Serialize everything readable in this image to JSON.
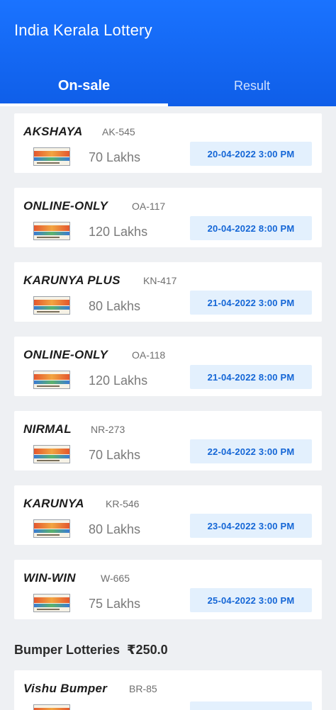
{
  "header": {
    "title": "India Kerala Lottery",
    "tabs": [
      {
        "label": "On-sale",
        "active": true
      },
      {
        "label": "Result",
        "active": false
      }
    ],
    "color": "#1a73ff"
  },
  "lotteries": [
    {
      "name": "AKSHAYA",
      "code": "AK-545",
      "prize": "70 Lakhs",
      "date": "20-04-2022  3:00 PM"
    },
    {
      "name": "ONLINE-ONLY",
      "code": "OA-117",
      "prize": "120 Lakhs",
      "date": "20-04-2022  8:00 PM"
    },
    {
      "name": "KARUNYA PLUS",
      "code": "KN-417",
      "prize": "80 Lakhs",
      "date": "21-04-2022  3:00 PM"
    },
    {
      "name": "ONLINE-ONLY",
      "code": "OA-118",
      "prize": "120 Lakhs",
      "date": "21-04-2022  8:00 PM"
    },
    {
      "name": "NIRMAL",
      "code": "NR-273",
      "prize": "70 Lakhs",
      "date": "22-04-2022  3:00 PM"
    },
    {
      "name": "KARUNYA",
      "code": "KR-546",
      "prize": "80 Lakhs",
      "date": "23-04-2022  3:00 PM"
    },
    {
      "name": "WIN-WIN",
      "code": "W-665",
      "prize": "75 Lakhs",
      "date": "25-04-2022  3:00 PM"
    }
  ],
  "bumper": {
    "title": "Bumper Lotteries",
    "price": "₹250.0",
    "items": [
      {
        "name": "Vishu Bumper",
        "code": "BR-85"
      }
    ]
  },
  "colors": {
    "badge_bg": "#e3f0fd",
    "badge_text": "#1466d6",
    "page_bg": "#eef0f3"
  },
  "icons": {
    "ticket": "lottery-ticket-thumbnail"
  }
}
